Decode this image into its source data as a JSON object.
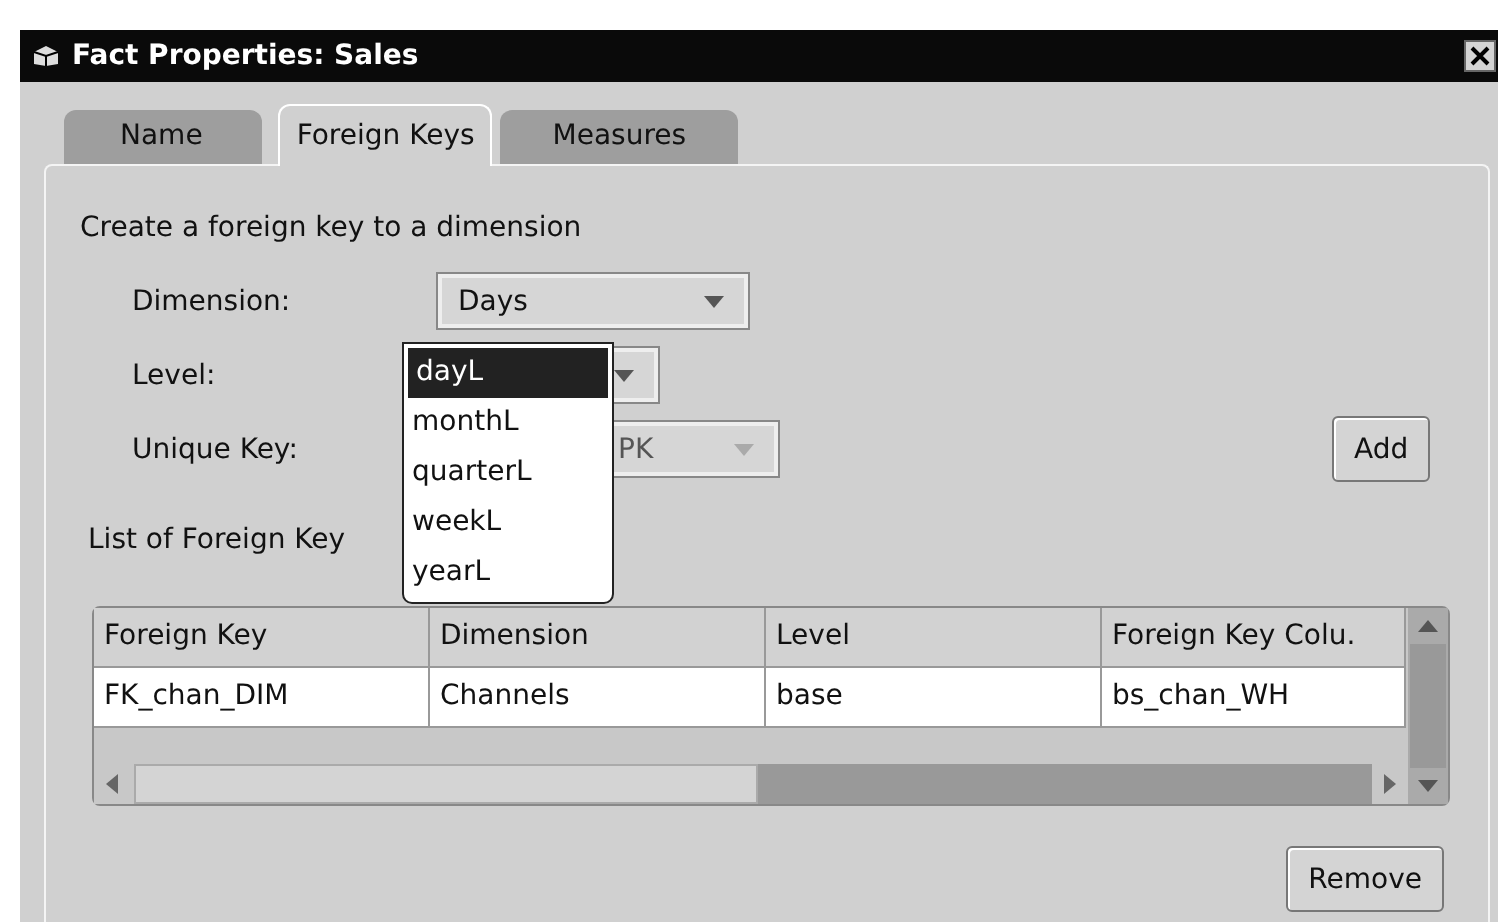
{
  "window": {
    "title": "Fact Properties: Sales"
  },
  "tabs": [
    {
      "label": "Name",
      "selected": false
    },
    {
      "label": "Foreign Keys",
      "selected": true
    },
    {
      "label": "Measures",
      "selected": false
    }
  ],
  "section_title": "Create a foreign key to a dimension",
  "fields": [
    {
      "label": "Dimension:",
      "value": "Days",
      "disabled": false
    },
    {
      "label": "Level:",
      "disabled": false,
      "open": true,
      "options": [
        {
          "label": "dayL",
          "selected": true
        },
        {
          "label": "monthL",
          "selected": false
        },
        {
          "label": "quarterL",
          "selected": false
        },
        {
          "label": "weekL",
          "selected": false
        },
        {
          "label": "yearL",
          "selected": false
        }
      ]
    },
    {
      "label": "Unique Key:",
      "value": "PK",
      "disabled": true
    }
  ],
  "add_button": "Add",
  "list_title": "List of Foreign Key",
  "table": {
    "columns": [
      "Foreign Key",
      "Dimension",
      "Level",
      "Foreign Key Colu."
    ],
    "rows": [
      [
        "FK_chan_DIM",
        "Channels",
        "base",
        "bs_chan_WH"
      ]
    ]
  },
  "remove_button": "Remove"
}
